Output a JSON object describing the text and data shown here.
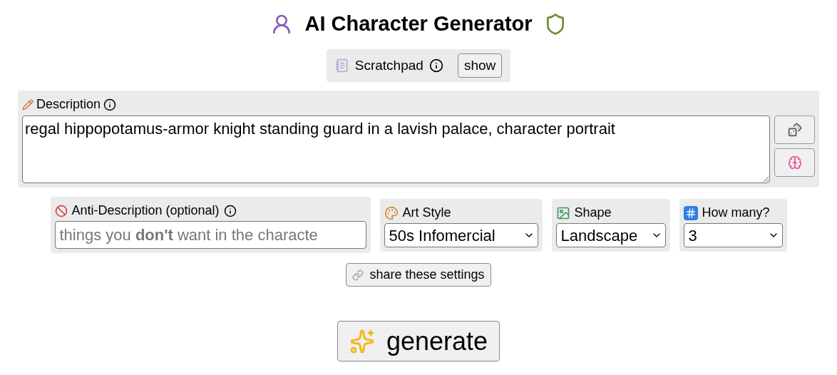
{
  "title": "AI Character Generator",
  "scratchpad": {
    "label": "Scratchpad",
    "button": "show"
  },
  "description": {
    "label": "Description",
    "value": "regal hippopotamus-armor knight standing guard in a lavish palace, character portrait"
  },
  "anti_description": {
    "label": "Anti-Description (optional)",
    "placeholder": "things you **don't** want in the characte"
  },
  "selects": [
    {
      "kind": "palette",
      "label": "Art Style",
      "value": "50s Infomercial"
    },
    {
      "kind": "image",
      "label": "Shape",
      "value": "Landscape"
    },
    {
      "kind": "numbers",
      "label": "How many?",
      "value": "3"
    }
  ],
  "share_button": "share these settings",
  "generate_button": "generate"
}
